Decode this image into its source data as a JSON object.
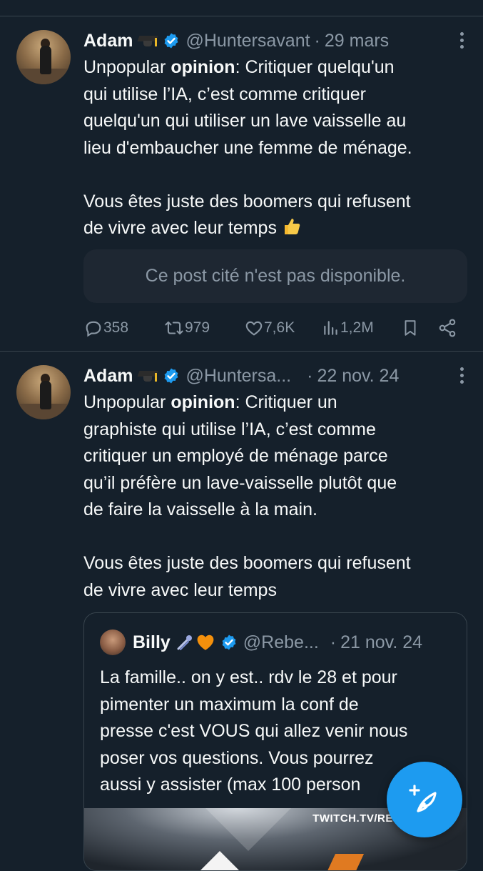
{
  "tweets": [
    {
      "name": "Adam",
      "handle": "@Huntersavant",
      "separator": "·",
      "date": "29 mars",
      "lines": [
        {
          "pre": "Unpopular ",
          "bold": "opinion",
          "post": ": Critiquer quelqu'un"
        },
        {
          "text": "qui utilise l’IA, c’est comme critiquer"
        },
        {
          "text": "quelqu'un qui utiliser un lave vaisselle au"
        },
        {
          "text": "lieu d'embaucher une femme de ménage."
        },
        {
          "text": ""
        },
        {
          "text": "Vous êtes juste des boomers qui refusent"
        },
        {
          "text": "de vivre avec leur temps"
        }
      ],
      "quote_unavailable": "Ce post cité n'est pas disponible.",
      "stats": {
        "replies": "358",
        "reposts": "979",
        "likes": "7,6K",
        "views": "1,2M"
      }
    },
    {
      "name": "Adam",
      "handle": "@Huntersa...",
      "separator": "·",
      "date": "22 nov. 24",
      "lines": [
        {
          "pre": "Unpopular ",
          "bold": "opinion",
          "post": ": Critiquer un"
        },
        {
          "text": "graphiste qui utilise l’IA, c’est comme"
        },
        {
          "text": "critiquer un employé de ménage parce"
        },
        {
          "text": "qu’il préfère un lave-vaisselle plutôt que"
        },
        {
          "text": "de faire la vaisselle à la main."
        },
        {
          "text": ""
        },
        {
          "text": "Vous êtes juste des boomers qui refusent"
        },
        {
          "text": "de vivre avec leur temps"
        }
      ],
      "quote": {
        "name": "Billy",
        "handle": "@Rebe...",
        "separator": "·",
        "date": "21 nov. 24",
        "lines": [
          "La famille.. on y est.. rdv le 28 et pour",
          "pimenter un maximum la conf de",
          "presse c'est VOUS qui allez venir nous",
          "poser vos questions. Vous pourrez",
          "aussi y assister (max 100 person"
        ],
        "image_label": "TWITCH.TV/REBEU"
      }
    }
  ],
  "icons": {
    "verified": "verified-badge-icon",
    "fab": "compose-post-icon"
  },
  "colors": {
    "background": "#15202b",
    "accent": "#1d9bf0",
    "secondary_text": "#8b98a5",
    "divider": "#38444d"
  }
}
